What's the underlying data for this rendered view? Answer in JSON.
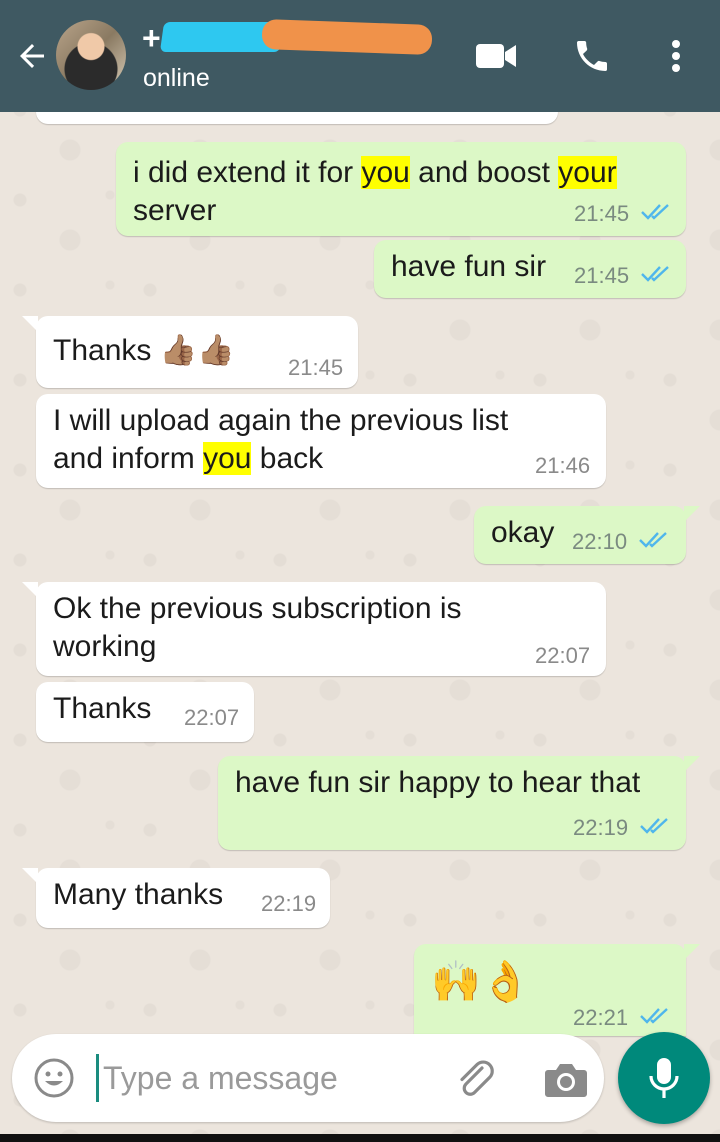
{
  "header": {
    "contact_name": "+",
    "status": "online"
  },
  "messages": [
    {
      "dir": "out",
      "parts": [
        [
          "i did extend it for ",
          false
        ],
        [
          "you",
          true
        ],
        [
          " and boost ",
          false
        ],
        [
          "your",
          true
        ]
      ],
      "line2": "server",
      "time": "21:45"
    },
    {
      "dir": "out",
      "text": "have fun sir",
      "time": "21:45"
    },
    {
      "dir": "in",
      "text": "Thanks 👍🏽👍🏽",
      "time": "21:45"
    },
    {
      "dir": "in",
      "line1": "I will upload again the previous list",
      "line2_parts": [
        [
          "and inform ",
          false
        ],
        [
          "you",
          true
        ],
        [
          " back",
          false
        ]
      ],
      "time": "21:46"
    },
    {
      "dir": "out",
      "text": "okay",
      "time": "22:10"
    },
    {
      "dir": "in",
      "line1": "Ok the previous subscription is",
      "line2": "working",
      "time": "22:07"
    },
    {
      "dir": "in",
      "text": "Thanks",
      "time": "22:07"
    },
    {
      "dir": "out",
      "text": "have fun sir happy to hear that",
      "time": "22:19"
    },
    {
      "dir": "in",
      "text": "Many thanks",
      "time": "22:19"
    },
    {
      "dir": "out",
      "text": "🙌👌",
      "time": "22:21"
    }
  ],
  "input": {
    "placeholder": "Type a message"
  },
  "colors": {
    "header": "#3f5962",
    "outgoing_bubble": "#dcf8c6",
    "incoming_bubble": "#ffffff",
    "read_ticks": "#4fb6ec",
    "mic_button": "#00897b",
    "highlight": "#ffff00"
  },
  "icons": [
    "back-arrow-icon",
    "video-call-icon",
    "phone-icon",
    "more-vert-icon",
    "emoji-icon",
    "attach-icon",
    "camera-icon",
    "mic-icon",
    "double-check-icon"
  ]
}
